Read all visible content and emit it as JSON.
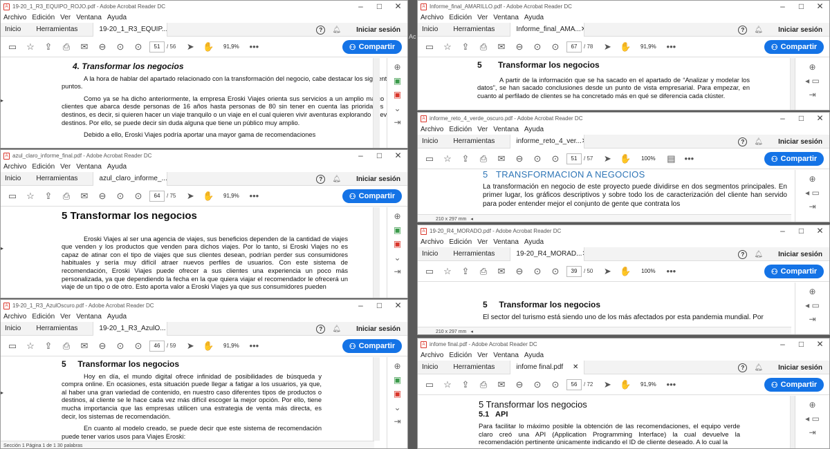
{
  "common": {
    "menu": [
      "Archivo",
      "Edición",
      "Ver",
      "Ventana",
      "Ayuda"
    ],
    "home": "Inicio",
    "tools": "Herramientas",
    "login": "Iniciar sesión",
    "share": "Compartir",
    "help": "?"
  },
  "w1": {
    "title": "19-20_1_R3_EQUIPO_ROJO.pdf - Adobe Acrobat Reader DC",
    "tab": "19-20_1_R3_EQUIP...",
    "page": "51",
    "total": "/ 56",
    "zoom": "91,9%",
    "heading": "4. Transformar los negocios",
    "p1": "A la hora de hablar del apartado relacionado con la transformación del negocio, cabe destacar los siguientes puntos.",
    "p2": "Como ya se ha dicho anteriormente, la empresa Eroski Viajes orienta sus servicios a un amplio marco de clientes que abarca desde personas de 16 años hasta personas de 80 sin tener en cuenta las prioridades de destinos, es decir, si quieren hacer un viaje tranquilo o un viaje en el cual quieren vivir aventuras explorando nuevos destinos. Por ello, se puede decir sin duda alguna que tiene un público muy amplio.",
    "p3": "Debido a ello, Eroski Viajes podría aportar una mayor gama de recomendaciones"
  },
  "w2": {
    "title": "azul_claro_informe_final.pdf - Adobe Acrobat Reader DC",
    "tab": "azul_claro_informe_...",
    "page": "64",
    "total": "/ 75",
    "zoom": "91,9%",
    "heading": "5  Transformar los negocios",
    "p1": "Eroski Viajes al ser una agencia de viajes, sus beneficios dependen de la cantidad de viajes que venden y los productos que venden para dichos viajes. Por lo tanto, si Eroski Viajes no es capaz de atinar con el tipo de viajes que sus clientes desean, podrían perder sus consumidores habituales y sería muy difícil atraer nuevos perfiles de usuarios. Con este sistema de recomendación, Eroski Viajes puede ofrecer a sus clientes una experiencia un poco más personalizada, ya que dependiendo la fecha en la que quiera viajar el recomendador le ofrecerá un viaje de un tipo o de otro. Esto aporta valor a Eroski Viajes ya que sus consumidores pueden"
  },
  "w3": {
    "title": "19-20_1_R3_AzulOscuro.pdf - Adobe Acrobat Reader DC",
    "tab": "19-20_1_R3_AzulO...",
    "page": "46",
    "total": "/ 59",
    "zoom": "91,9%",
    "heading": "5     Transformar los negocios",
    "p1": "Hoy en día, el mundo digital ofrece infinidad de posibilidades de búsqueda y compra online. En ocasiones, esta situación puede llegar a fatigar a los usuarios, ya que, al haber una gran variedad de contenido, en nuestro caso diferentes tipos de productos o destinos, al cliente se le hace cada vez más difícil escoger la mejor opción. Por ello, tiene mucha importancia que las empresas utilicen una estrategia de venta más directa, es decir, los sistemas de recomendación.",
    "p2": "En cuanto al modelo creado, se puede decir que este sistema de recomendación puede tener varios usos para Viajes Eroski:",
    "status": "Sección 1    Página 1 de 1    30 palabras"
  },
  "w4": {
    "title": "Informe_final_AMARILLO.pdf - Adobe Acrobat Reader DC",
    "tab": "Informe_final_AMA...",
    "page": "67",
    "total": "/ 78",
    "zoom": "91,9%",
    "heading": "5       Transformar los negocios",
    "p1": "A partir de la información que se ha sacado en el apartado de “Analizar y modelar los datos”, se han sacado conclusiones desde un punto de vista empresarial. Para empezar, en cuanto al perfilado de clientes se ha concretado más en qué se diferencia cada clúster."
  },
  "w5": {
    "title": "informe_reto_4_verde_oscuro.pdf - Adobe Acrobat Reader DC",
    "tab": "informe_reto_4_ver...",
    "page": "51",
    "total": "/ 57",
    "zoom": "100%",
    "heading": "5   TRANSFORMACIÓN A NEGOCIOS",
    "p1": "La transformación en negocio de este proyecto puede dividirse en dos segmentos principales. En primer lugar, los gráficos descriptivos y sobre todo los de caracterización del cliente han servido para poder entender mejor el conjunto de gente que contrata los",
    "size": "210 x 297 mm"
  },
  "w6": {
    "title": "19-20_R4_MORADO.pdf - Adobe Acrobat Reader DC",
    "tab": "19-20_R4_MORAD...",
    "page": "39",
    "total": "/ 50",
    "zoom": "100%",
    "heading": "5     Transformar los negocios",
    "p1": "El sector del turismo está siendo uno de los más afectados por esta pandemia mundial. Por",
    "size": "210 x 297 mm"
  },
  "w7": {
    "title": "infome final.pdf - Adobe Acrobat Reader DC",
    "tab": "infome final.pdf",
    "page": "56",
    "total": "/ 72",
    "zoom": "91,9%",
    "heading": "5  Transformar los negocios",
    "sub": "5.1   API",
    "p1": "Para facilitar lo máximo posible la obtención de las recomendaciones, el equipo verde claro creó una API (Application Programming Interface) la cual devuelve la recomendación pertinente únicamente indicando el ID de cliente deseado. A lo cual la"
  },
  "bg": {
    "frag": "Ac"
  }
}
